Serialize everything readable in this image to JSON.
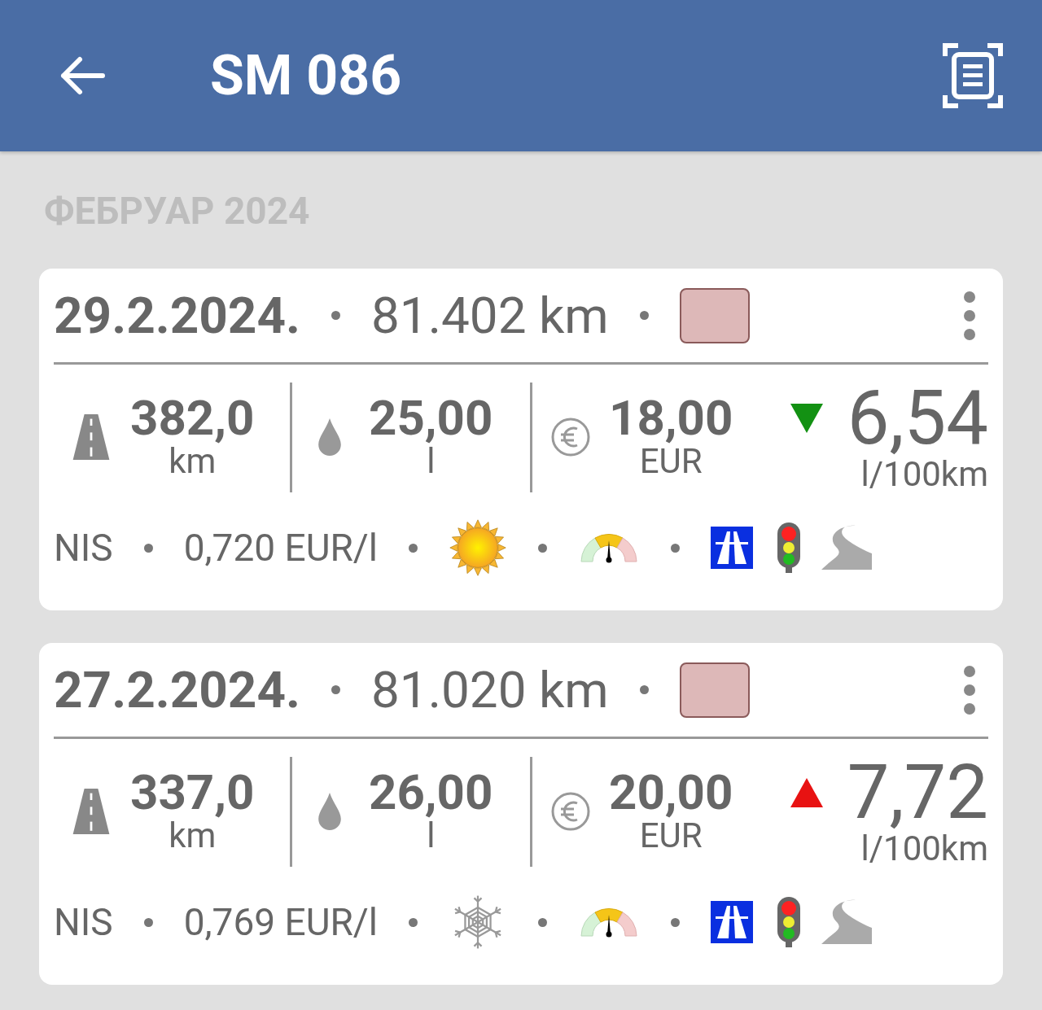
{
  "header": {
    "title": "SM 086"
  },
  "section": {
    "title": "ФЕБРУАР 2024"
  },
  "entries": [
    {
      "date": "29.2.2024.",
      "odometer": "81.402 km",
      "color": "#ddb8b8",
      "distance": "382,0",
      "distance_unit": "km",
      "volume": "25,00",
      "volume_unit": "l",
      "cost": "18,00",
      "cost_unit": "EUR",
      "rising": false,
      "consumption": "6,54",
      "consumption_unit": "l/100km",
      "station": "NIS",
      "price": "0,720 EUR/l",
      "snowy": false
    },
    {
      "date": "27.2.2024.",
      "odometer": "81.020 km",
      "color": "#ddb8b8",
      "distance": "337,0",
      "distance_unit": "km",
      "volume": "26,00",
      "volume_unit": "l",
      "cost": "20,00",
      "cost_unit": "EUR",
      "rising": true,
      "consumption": "7,72",
      "consumption_unit": "l/100km",
      "station": "NIS",
      "price": "0,769 EUR/l",
      "snowy": true
    }
  ]
}
